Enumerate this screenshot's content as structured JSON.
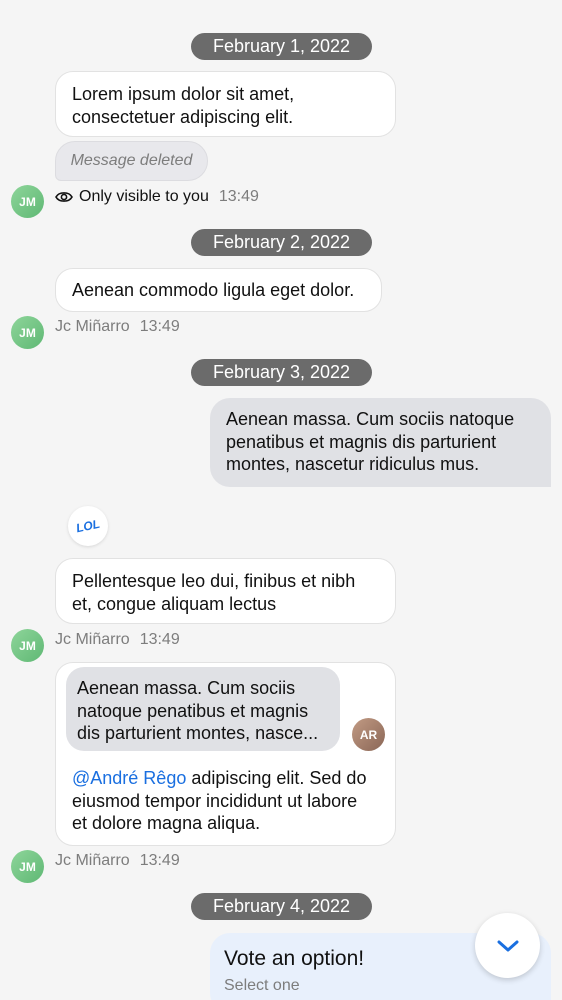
{
  "colors": {
    "background": "#f5f5f5",
    "date_pill": "#6b6b6b",
    "outgoing_bubble": "#e0e1e5",
    "mention": "#1a6fe0",
    "poll_bg": "#e8f0fc",
    "avatar_green": "#5fb874"
  },
  "dates": {
    "d1": "February 1, 2022",
    "d2": "February 2, 2022",
    "d3": "February 3, 2022",
    "d4": "February 4, 2022"
  },
  "messages": {
    "m1": {
      "line1": "Lorem ipsum dolor sit amet,",
      "line2": "consectetuer adipiscing elit."
    },
    "deleted": "Message deleted",
    "visible": {
      "icon": "eye-icon",
      "label": "Only visible to you",
      "time": "13:49"
    },
    "m2": {
      "text": "Aenean commodo ligula eget dolor.",
      "author": "Jc Miñarro",
      "time": "13:49"
    },
    "m3": {
      "line1": "Aenean massa. Cum sociis natoque",
      "line2": "penatibus et magnis dis parturient",
      "line3": "montes, nascetur ridiculus mus."
    },
    "m4": {
      "reaction_icon": "lol-reaction-icon",
      "reaction_text": "LOL",
      "line1": "Pellentesque leo dui, finibus et nibh",
      "line2": "et, congue aliquam lectus",
      "author": "Jc Miñarro",
      "time": "13:49"
    },
    "m5": {
      "quote_line1": "Aenean massa. Cum sociis",
      "quote_line2": "natoque penatibus et magnis",
      "quote_line3": "dis parturient montes, nasce...",
      "quote_avatar": "AR",
      "mention": "@André Rêgo",
      "text_after_mention": " adipiscing elit. Sed do",
      "line2": "eiusmod tempor incididunt ut labore",
      "line3": "et dolore magna aliqua.",
      "author": "Jc Miñarro",
      "time": "13:49"
    },
    "poll": {
      "title": "Vote an option!",
      "subtitle": "Select one"
    }
  },
  "avatar_initials": "JM",
  "scroll_button_icon": "chevron-down-icon"
}
